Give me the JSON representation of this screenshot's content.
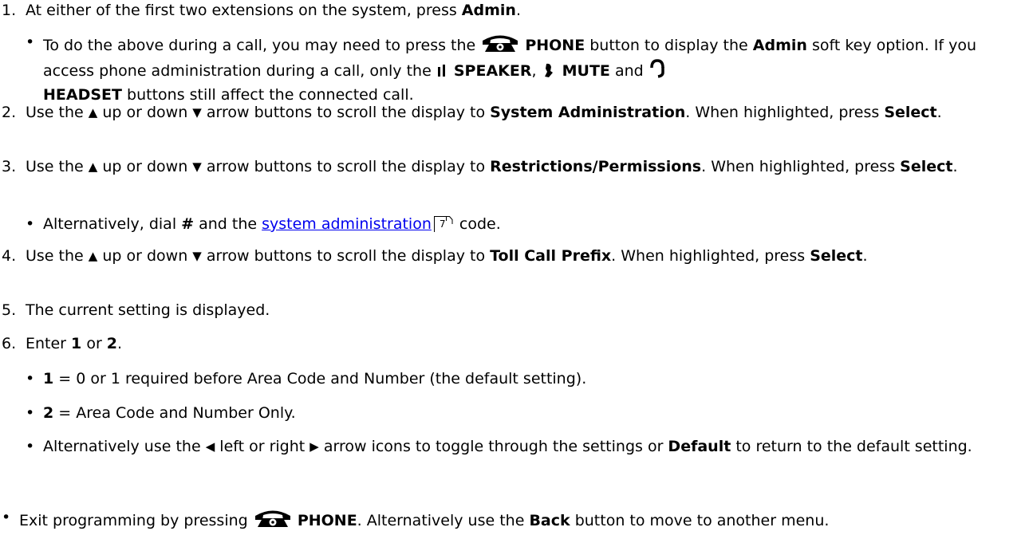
{
  "steps": [
    {
      "num": "1.",
      "pre": "At either of the first two extensions on the system, press ",
      "b1": "Admin",
      "post": ".",
      "note": {
        "t1": "To do the above during a call, you may need to press the ",
        "phone_label": "PHONE",
        "t2": " button to display the ",
        "admin": "Admin",
        "t3": " soft key option. If you access phone administration during a call, only the ",
        "speaker": "SPEAKER",
        "t4": ", ",
        "mute": "MUTE",
        "t5": " and ",
        "headset": "HEADSET",
        "t6": " buttons still affect the connected call."
      }
    },
    {
      "num": "2.",
      "pre": "Use the ",
      "mid": " up or down ",
      "post1": " arrow buttons to scroll the display to ",
      "target": "System Administration",
      "post2": ". When highlighted, press ",
      "select": "Select",
      "end": "."
    },
    {
      "num": "3.",
      "pre": "Use the ",
      "mid": " up or down ",
      "post1": " arrow buttons to scroll the display to ",
      "target": "Restrictions/Permissions",
      "post2": ". When highlighted, press ",
      "select": "Select",
      "end": ".",
      "note": {
        "t1": "Alternatively, dial ",
        "hash": "#",
        "t2": " and the ",
        "link": "system administration",
        "ref": "7",
        "t3": " code."
      }
    },
    {
      "num": "4.",
      "pre": "Use the ",
      "mid": " up or down ",
      "post1": " arrow buttons to scroll the display to ",
      "target": "Toll Call Prefix",
      "post2": ". When highlighted, press ",
      "select": "Select",
      "end": "."
    },
    {
      "num": "5.",
      "text": "The current setting is displayed."
    },
    {
      "num": "6.",
      "pre": "Enter ",
      "o1": "1",
      "or": " or ",
      "o2": "2",
      "end": ".",
      "notes": [
        {
          "key": "1",
          "text": " = 0 or 1 required before Area Code and Number (the default setting)."
        },
        {
          "key": "2",
          "text": " = Area Code and Number Only."
        }
      ],
      "alt": {
        "t1": "Alternatively use the ",
        "t2": " left or right ",
        "t3": " arrow icons to toggle through the settings or ",
        "default": "Default",
        "t4": " to return to the default setting."
      }
    }
  ],
  "exit": {
    "t1": "Exit programming by pressing ",
    "phone_label": "PHONE",
    "t2": ". Alternatively use the ",
    "back": "Back",
    "t3": " button to move to another menu."
  },
  "glyphs": {
    "bullet": "•",
    "up_arrow": "▲",
    "down_arrow": "▼",
    "left_arrow": "◀",
    "right_arrow": "▶"
  },
  "icons": {
    "phone": "phone-icon",
    "speaker": "speaker-icon",
    "mute": "mute-icon",
    "headset": "headset-icon",
    "xref": "page-reference-icon"
  }
}
